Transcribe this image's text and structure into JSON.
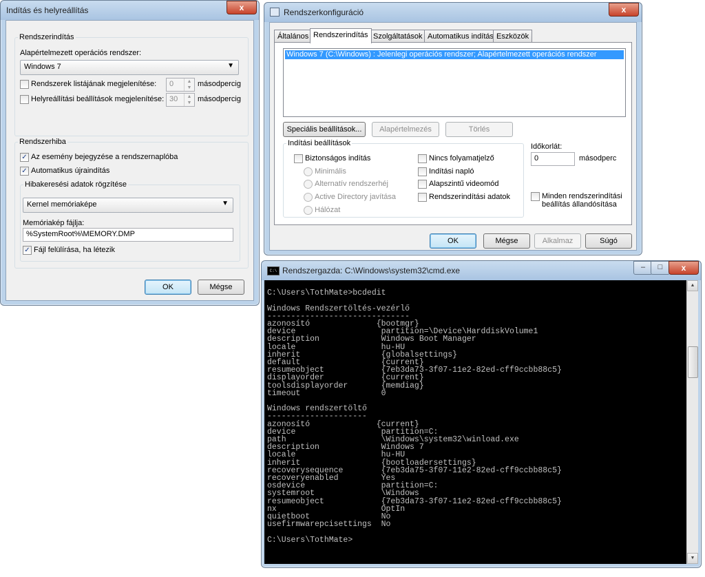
{
  "startup_recovery": {
    "title": "Indítás és helyreállítás",
    "close_label": "x",
    "system_startup": {
      "legend": "Rendszerindítás",
      "default_os_label": "Alapértelmezett operációs rendszer:",
      "default_os_value": "Windows 7",
      "show_list_label": "Rendszerek listájának megjelenítése:",
      "show_list_value": "0",
      "show_recovery_label": "Helyreállítási beállítások megjelenítése:",
      "show_recovery_value": "30",
      "seconds": "másodpercig"
    },
    "system_failure": {
      "legend": "Rendszerhiba",
      "write_event_label": "Az esemény bejegyzése a rendszernaplóba",
      "auto_restart_label": "Automatikus újraindítás",
      "debug_legend": "Hibakeresési adatok rögzítése",
      "dump_type_value": "Kernel memóriaképe",
      "dump_file_label": "Memóriakép fájlja:",
      "dump_file_value": "%SystemRoot%\\MEMORY.DMP",
      "overwrite_label": "Fájl felülírása, ha létezik"
    },
    "ok_label": "OK",
    "cancel_label": "Mégse"
  },
  "msconfig": {
    "title": "Rendszerkonfiguráció",
    "close_label": "x",
    "tabs": [
      "Általános",
      "Rendszerindítás",
      "Szolgáltatások",
      "Automatikus indítás",
      "Eszközök"
    ],
    "boot_entry": "Windows 7 (C:\\Windows) : Jelenlegi operációs rendszer; Alapértelmezett operációs rendszer",
    "advanced_label": "Speciális beállítások...",
    "set_default_label": "Alapértelmezés",
    "delete_label": "Törlés",
    "boot_options": {
      "legend": "Indítási beállítások",
      "safe_boot": "Biztonságos indítás",
      "minimal": "Minimális",
      "alternate_shell": "Alternatív rendszerhéj",
      "ad_repair": "Active Directory javítása",
      "network": "Hálózat",
      "no_gui": "Nincs folyamatjelző",
      "boot_log": "Indítási napló",
      "base_video": "Alapszintű videomód",
      "os_boot_info": "Rendszerindítási adatok"
    },
    "timeout_label": "Időkorlát:",
    "timeout_value": "0",
    "timeout_unit": "másodperc",
    "permanent_label_1": "Minden rendszerindítási",
    "permanent_label_2": "beállítás állandósítása",
    "ok_label": "OK",
    "cancel_label": "Mégse",
    "apply_label": "Alkalmaz",
    "help_label": "Súgó"
  },
  "cmd": {
    "title": "Rendszergazda: C:\\Windows\\system32\\cmd.exe",
    "icon_text": "C:\\",
    "minimize": "–",
    "maximize": "□",
    "close": "x",
    "lines": [
      "",
      "C:\\Users\\TothMate>bcdedit",
      "",
      "Windows Rendszertöltés-vezérlő",
      "------------------------------",
      "azonosító              {bootmgr}",
      "device                  partition=\\Device\\HarddiskVolume1",
      "description             Windows Boot Manager",
      "locale                  hu-HU",
      "inherit                 {globalsettings}",
      "default                 {current}",
      "resumeobject            {7eb3da73-3f07-11e2-82ed-cff9ccbb88c5}",
      "displayorder            {current}",
      "toolsdisplayorder       {memdiag}",
      "timeout                 0",
      "",
      "Windows rendszertöltő",
      "---------------------",
      "azonosító              {current}",
      "device                  partition=C:",
      "path                    \\Windows\\system32\\winload.exe",
      "description             Windows 7",
      "locale                  hu-HU",
      "inherit                 {bootloadersettings}",
      "recoverysequence        {7eb3da75-3f07-11e2-82ed-cff9ccbb88c5}",
      "recoveryenabled         Yes",
      "osdevice                partition=C:",
      "systemroot              \\Windows",
      "resumeobject            {7eb3da73-3f07-11e2-82ed-cff9ccbb88c5}",
      "nx                      OptIn",
      "quietboot               No",
      "usefirmwarepcisettings  No",
      "",
      "C:\\Users\\TothMate>"
    ]
  }
}
